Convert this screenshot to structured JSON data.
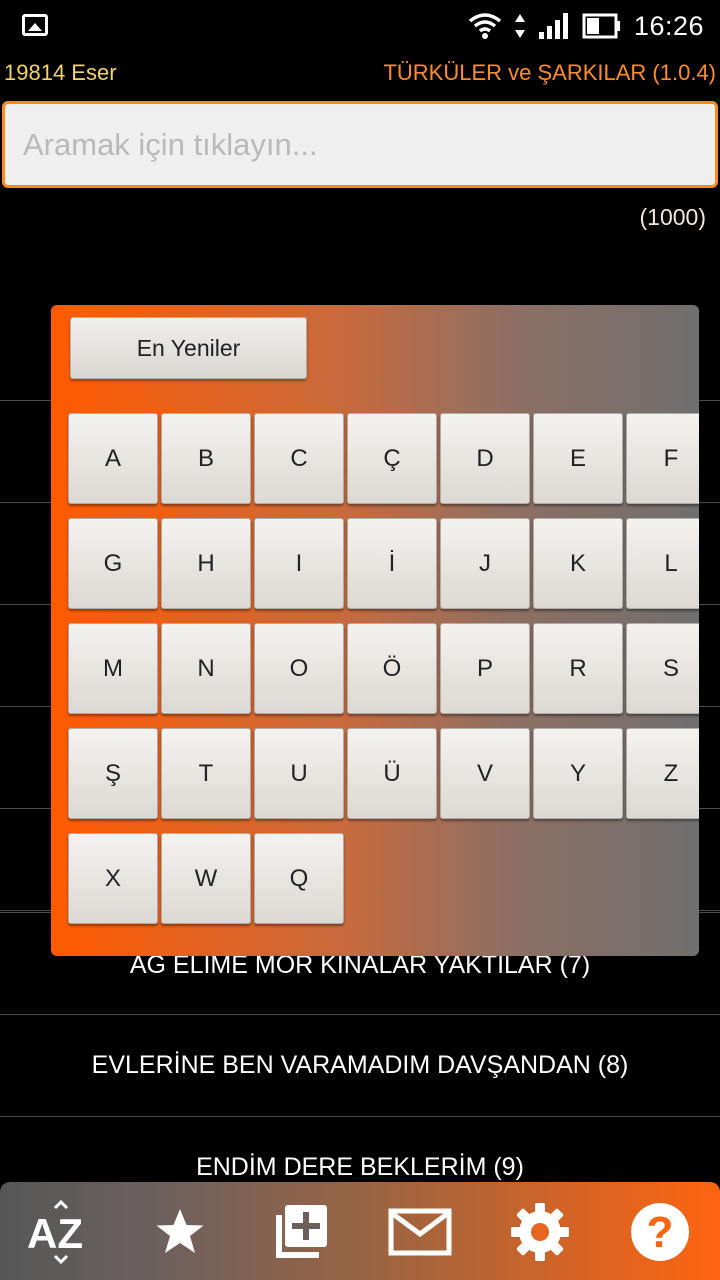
{
  "status_bar": {
    "time": "16:26"
  },
  "header": {
    "count_label": "19814 Eser",
    "app_title": "TÜRKÜLER ve ŞARKILAR (1.0.4)"
  },
  "search": {
    "placeholder": "Aramak için tıklayın...",
    "value": "",
    "result_count": "(1000)"
  },
  "list": {
    "items": [
      {
        "label": ""
      },
      {
        "label": ""
      },
      {
        "label": ""
      },
      {
        "label": ""
      },
      {
        "label": ""
      },
      {
        "label": ""
      },
      {
        "label": "AĞ ELİME MOR KINALAR YAKTILAR (7)"
      },
      {
        "label": "EVLERİNE BEN VARAMADIM DAVŞANDAN (8)"
      },
      {
        "label": "ENDİM DERE BEKLERİM (9)"
      }
    ]
  },
  "alphabet_panel": {
    "newest_label": "En Yeniler",
    "letters": [
      "A",
      "B",
      "C",
      "Ç",
      "D",
      "E",
      "F",
      "G",
      "H",
      "I",
      "İ",
      "J",
      "K",
      "L",
      "M",
      "N",
      "O",
      "Ö",
      "P",
      "R",
      "S",
      "Ş",
      "T",
      "U",
      "Ü",
      "V",
      "Y",
      "Z",
      "X",
      "W",
      "Q"
    ]
  },
  "bottom_nav": {
    "items": [
      {
        "icon": "sort-az-icon",
        "label": "AZ"
      },
      {
        "icon": "star-icon"
      },
      {
        "icon": "add-to-library-icon"
      },
      {
        "icon": "mail-icon"
      },
      {
        "icon": "gear-icon"
      },
      {
        "icon": "help-icon",
        "label": "?"
      }
    ]
  },
  "colors": {
    "accent": "#ff6410",
    "count_color": "#f2d36b",
    "title_color": "#ff8c2a"
  }
}
